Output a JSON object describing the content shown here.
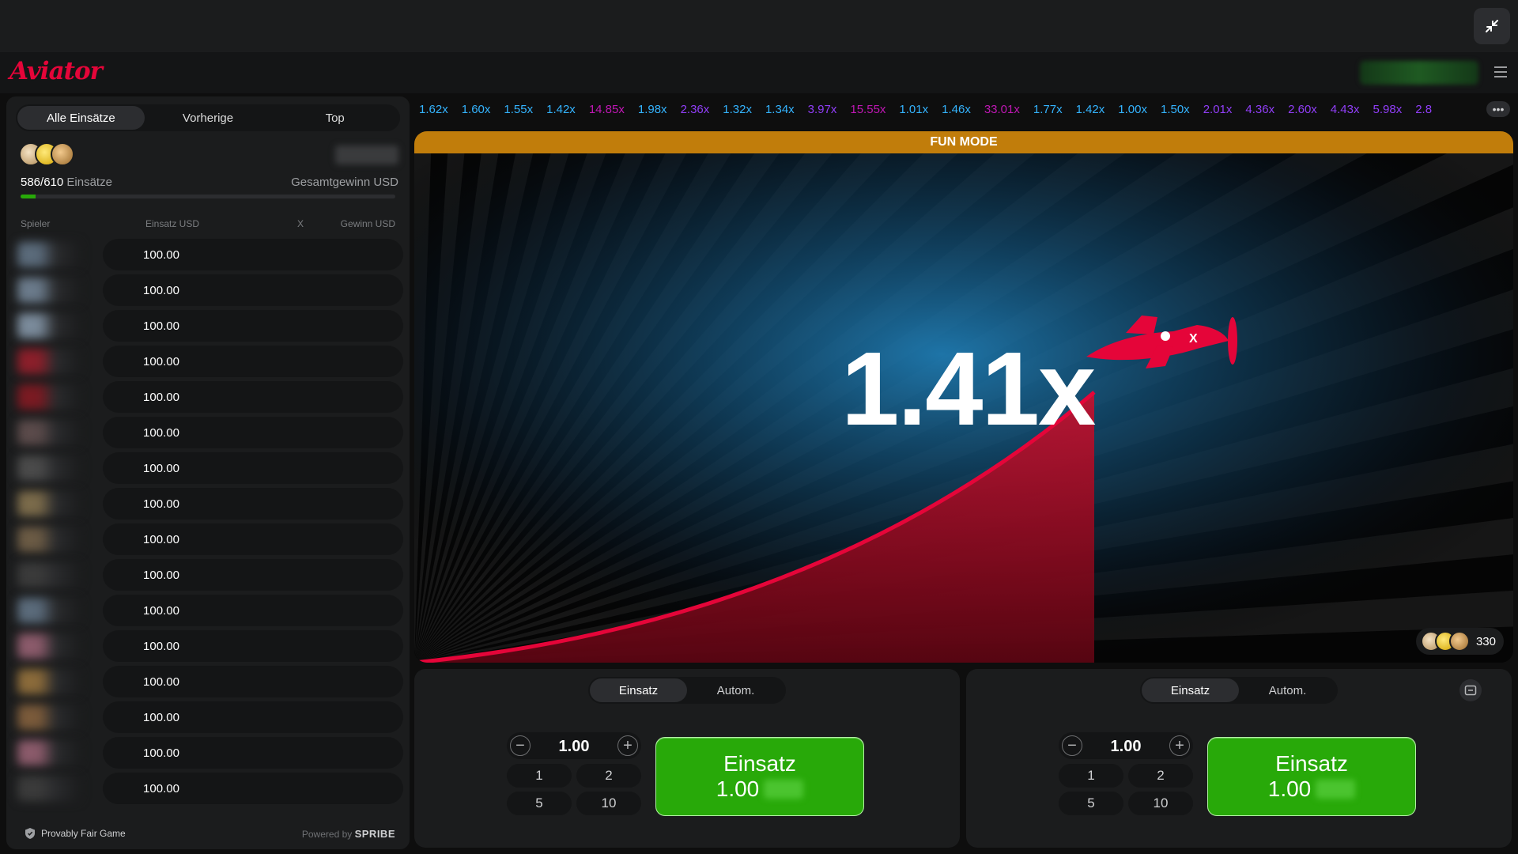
{
  "app": {
    "logo": "Aviator"
  },
  "left_panel": {
    "tabs": [
      {
        "label": "Alle Einsätze",
        "active": true
      },
      {
        "label": "Vorherige",
        "active": false
      },
      {
        "label": "Top",
        "active": false
      }
    ],
    "bets_count": "586/610",
    "bets_label": "Einsätze",
    "total_win_label": "Gesamtgewinn USD",
    "progress_fraction": 0.04,
    "columns": {
      "player": "Spieler",
      "bet": "Einsatz USD",
      "x": "X",
      "win": "Gewinn USD"
    },
    "rows": [
      {
        "amount": "100.00",
        "tint": "#5a6a7a"
      },
      {
        "amount": "100.00",
        "tint": "#6a7a8a"
      },
      {
        "amount": "100.00",
        "tint": "#7a8a9a"
      },
      {
        "amount": "100.00",
        "tint": "#8a1f2a"
      },
      {
        "amount": "100.00",
        "tint": "#7a1a22"
      },
      {
        "amount": "100.00",
        "tint": "#5a4a4a"
      },
      {
        "amount": "100.00",
        "tint": "#4a4a4a"
      },
      {
        "amount": "100.00",
        "tint": "#7a6a4a"
      },
      {
        "amount": "100.00",
        "tint": "#6a5a44"
      },
      {
        "amount": "100.00",
        "tint": "#3a3a3a"
      },
      {
        "amount": "100.00",
        "tint": "#5a6a7a"
      },
      {
        "amount": "100.00",
        "tint": "#8a5a6a"
      },
      {
        "amount": "100.00",
        "tint": "#8a6a3a"
      },
      {
        "amount": "100.00",
        "tint": "#7a5a3a"
      },
      {
        "amount": "100.00",
        "tint": "#8a5a6a"
      },
      {
        "amount": "100.00",
        "tint": "#3a3a3a"
      }
    ],
    "footer": {
      "provably_fair": "Provably Fair Game",
      "powered_by": "Powered by",
      "brand": "SPRIBE"
    }
  },
  "history": [
    {
      "value": "1.62x",
      "color": "#34b4ff"
    },
    {
      "value": "1.60x",
      "color": "#34b4ff"
    },
    {
      "value": "1.55x",
      "color": "#34b4ff"
    },
    {
      "value": "1.42x",
      "color": "#34b4ff"
    },
    {
      "value": "14.85x",
      "color": "#c017b4"
    },
    {
      "value": "1.98x",
      "color": "#34b4ff"
    },
    {
      "value": "2.36x",
      "color": "#913ef8"
    },
    {
      "value": "1.32x",
      "color": "#34b4ff"
    },
    {
      "value": "1.34x",
      "color": "#34b4ff"
    },
    {
      "value": "3.97x",
      "color": "#913ef8"
    },
    {
      "value": "15.55x",
      "color": "#c017b4"
    },
    {
      "value": "1.01x",
      "color": "#34b4ff"
    },
    {
      "value": "1.46x",
      "color": "#34b4ff"
    },
    {
      "value": "33.01x",
      "color": "#c017b4"
    },
    {
      "value": "1.77x",
      "color": "#34b4ff"
    },
    {
      "value": "1.42x",
      "color": "#34b4ff"
    },
    {
      "value": "1.00x",
      "color": "#34b4ff"
    },
    {
      "value": "1.50x",
      "color": "#34b4ff"
    },
    {
      "value": "2.01x",
      "color": "#913ef8"
    },
    {
      "value": "4.36x",
      "color": "#913ef8"
    },
    {
      "value": "2.60x",
      "color": "#913ef8"
    },
    {
      "value": "4.43x",
      "color": "#913ef8"
    },
    {
      "value": "5.98x",
      "color": "#913ef8"
    },
    {
      "value": "2.8",
      "color": "#913ef8"
    }
  ],
  "game": {
    "mode_banner": "FUN MODE",
    "multiplier": "1.41x",
    "players_online": "330",
    "curve_color": "#e50539"
  },
  "bet_panels": [
    {
      "tabs": [
        {
          "label": "Einsatz",
          "active": true
        },
        {
          "label": "Autom.",
          "active": false
        }
      ],
      "stake": "1.00",
      "minus": "−",
      "plus": "+",
      "quick": [
        "1",
        "2",
        "5",
        "10"
      ],
      "button_label": "Einsatz",
      "button_amount": "1.00"
    },
    {
      "tabs": [
        {
          "label": "Einsatz",
          "active": true
        },
        {
          "label": "Autom.",
          "active": false
        }
      ],
      "stake": "1.00",
      "minus": "−",
      "plus": "+",
      "quick": [
        "1",
        "2",
        "5",
        "10"
      ],
      "button_label": "Einsatz",
      "button_amount": "1.00"
    }
  ],
  "colors": {
    "accent_green": "#28a909",
    "brand_red": "#e50539",
    "fun_mode": "#c17d0b"
  }
}
